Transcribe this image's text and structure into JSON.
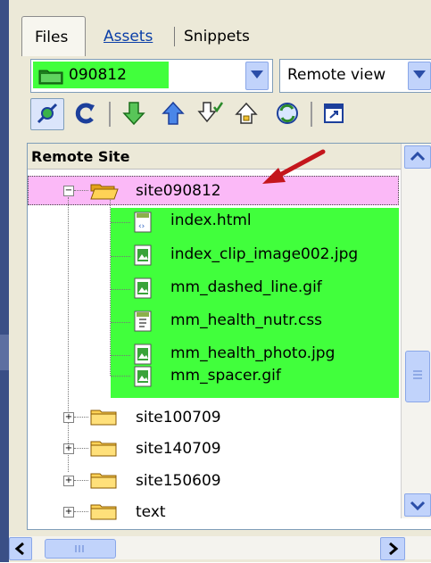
{
  "tabs": [
    {
      "label": "Files",
      "active": true
    },
    {
      "label": "Assets",
      "link": true
    },
    {
      "label": "Snippets"
    }
  ],
  "site_select": {
    "value": "090812",
    "highlight_color": "#41ff3c"
  },
  "view_select": {
    "value": "Remote view"
  },
  "toolbar": {
    "icons": [
      "connect-icon",
      "refresh-icon",
      "get-icon",
      "put-icon",
      "check-out-icon",
      "check-in-icon",
      "synchronize-icon",
      "expand-icon"
    ]
  },
  "tree": {
    "header": "Remote Site",
    "open_folder": {
      "name": "site090812",
      "highlight_color": "#fbb9f7"
    },
    "files": [
      {
        "name": "index.html",
        "icon": "html-file-icon"
      },
      {
        "name": "index_clip_image002.jpg",
        "icon": "image-file-icon"
      },
      {
        "name": "mm_dashed_line.gif",
        "icon": "image-file-icon"
      },
      {
        "name": "mm_health_nutr.css",
        "icon": "css-file-icon"
      },
      {
        "name": "mm_health_photo.jpg",
        "icon": "image-file-icon"
      },
      {
        "name": "mm_spacer.gif",
        "icon": "image-file-icon"
      }
    ],
    "files_highlight_color": "#41ff3c",
    "folders": [
      "site100709",
      "site140709",
      "site150609",
      "text"
    ]
  },
  "annotation": {
    "arrow_color": "#c4161c"
  }
}
